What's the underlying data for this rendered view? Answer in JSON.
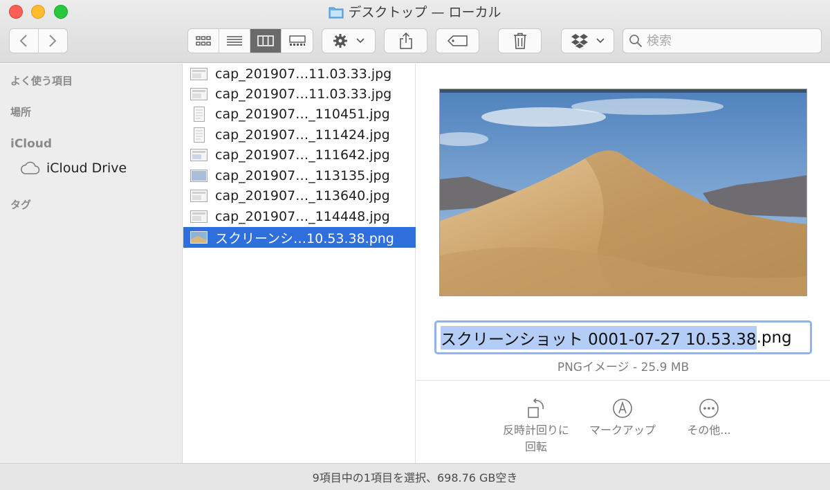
{
  "window": {
    "title": "デスクトップ — ローカル"
  },
  "toolbar": {
    "back_icon": "chevron-left-icon",
    "forward_icon": "chevron-right-icon",
    "view_modes": [
      "icon-view-icon",
      "list-view-icon",
      "column-view-icon",
      "gallery-view-icon"
    ],
    "active_view": "column-view-icon",
    "action_icon": "gear-icon",
    "share_icon": "share-icon",
    "tag_icon": "tag-icon",
    "trash_icon": "trash-icon",
    "dropbox_icon": "dropbox-icon",
    "search_placeholder": "検索"
  },
  "sidebar": {
    "sections": [
      {
        "label": "よく使う項目"
      },
      {
        "label": "場所"
      },
      {
        "label": "iCloud"
      },
      {
        "label": "タグ"
      }
    ],
    "items": [
      {
        "label": "iCloud Drive",
        "icon": "cloud-icon"
      }
    ]
  },
  "files": [
    {
      "name": "cap_201907…11.03.33.jpg",
      "icon": "screenshot-thumb-icon"
    },
    {
      "name": "cap_201907…11.03.33.jpg",
      "icon": "screenshot-thumb-icon"
    },
    {
      "name": "cap_201907…_110451.jpg",
      "icon": "document-thumb-icon"
    },
    {
      "name": "cap_201907…_111424.jpg",
      "icon": "document-thumb-icon"
    },
    {
      "name": "cap_201907…_111642.jpg",
      "icon": "screenshot-thumb-icon"
    },
    {
      "name": "cap_201907…_113135.jpg",
      "icon": "screenshot-thumb-icon"
    },
    {
      "name": "cap_201907…_113640.jpg",
      "icon": "screenshot-thumb-icon"
    },
    {
      "name": "cap_201907…_114448.jpg",
      "icon": "screenshot-thumb-icon"
    },
    {
      "name": "スクリーンシ…10.53.38.png",
      "icon": "desert-thumb-icon",
      "selected": true
    }
  ],
  "preview": {
    "filename_selected": "スクリーンショット 0001-07-27 10.53.38",
    "filename_ext": ".png",
    "kind": "PNGイメージ - 25.9 MB",
    "actions": [
      {
        "line1": "反時計回りに",
        "line2": "回転",
        "icon": "rotate-left-icon"
      },
      {
        "line1": "マークアップ",
        "line2": "",
        "icon": "markup-icon"
      },
      {
        "line1": "その他...",
        "line2": "",
        "icon": "more-icon"
      }
    ]
  },
  "status": {
    "text": "9項目中の1項目を選択、698.76 GB空き"
  },
  "colors": {
    "selection": "#2f6fdb",
    "sidebar_bg": "#ededed",
    "rename_highlight": "#b3cdf6"
  }
}
